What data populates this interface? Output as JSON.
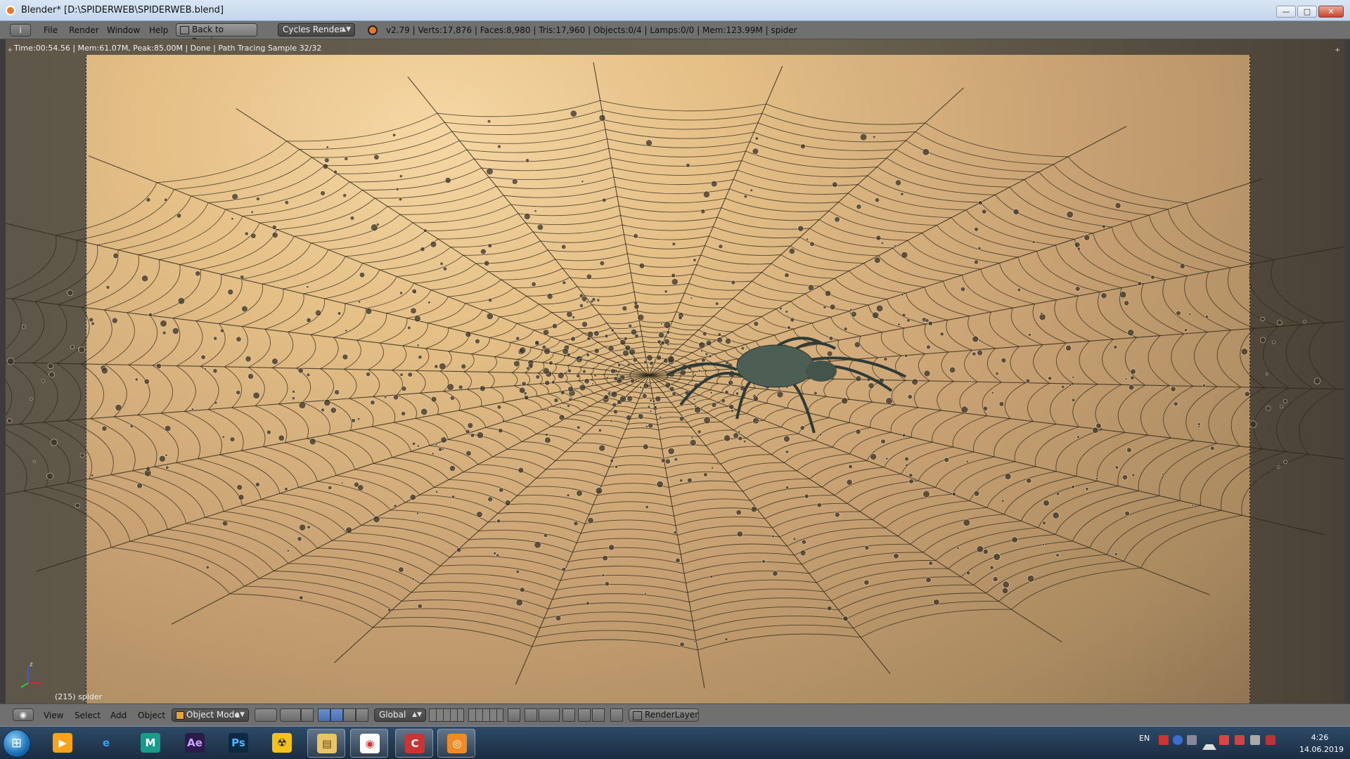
{
  "window": {
    "title": "Blender* [D:\\SPIDERWEB\\SPIDERWEB.blend]",
    "min": "—",
    "max": "□",
    "close": "✕"
  },
  "header": {
    "editor_icon": "i",
    "menu": [
      "File",
      "Render",
      "Window",
      "Help"
    ],
    "back_button": "Back to Previous",
    "engine": "Cycles Render",
    "stats": "v2.79 | Verts:17,876 | Faces:8,980 | Tris:17,960 | Objects:0/4 | Lamps:0/0 | Mem:123.99M | spider"
  },
  "viewport": {
    "render_status": "Time:00:54.56 | Mem:61.07M, Peak:85.00M | Done | Path Tracing Sample 32/32",
    "object_label": "(215) spider",
    "colors": {
      "bg_top": "#f6d7a3",
      "bg_bottom": "#8f7453",
      "web": "#2c2518"
    }
  },
  "bottom_bar": {
    "menu": [
      "View",
      "Select",
      "Add",
      "Object"
    ],
    "mode": "Object Mode",
    "orientation": "Global",
    "render_layer": "RenderLayer"
  },
  "taskbar": {
    "apps": [
      {
        "name": "media-player",
        "label": "▶"
      },
      {
        "name": "internet-explorer",
        "label": "e"
      },
      {
        "name": "maya",
        "label": "M"
      },
      {
        "name": "after-effects",
        "label": "Ae"
      },
      {
        "name": "photoshop",
        "label": "Ps"
      },
      {
        "name": "nuke",
        "label": "☢"
      },
      {
        "name": "file-explorer",
        "label": "▤"
      },
      {
        "name": "chrome",
        "label": "◉"
      },
      {
        "name": "ccleaner",
        "label": "C"
      },
      {
        "name": "blender",
        "label": "◎"
      }
    ],
    "lang": "EN",
    "time": "4:26",
    "date": "14.06.2019"
  }
}
